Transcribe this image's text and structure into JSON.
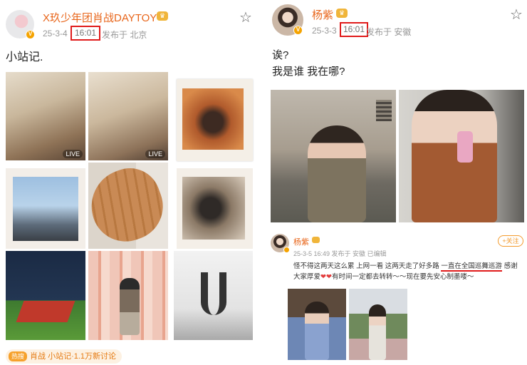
{
  "left_post": {
    "username": "X玖少年团肖战DAYTOY",
    "date": "25-3-4",
    "time": "16:01",
    "location": "发布于 北京",
    "text": "小站记.",
    "live_label_1": "LIVE",
    "live_label_2": "LIVE",
    "topic_chip": {
      "tag": "热搜",
      "text": "肖战 小站记·1.1万新讨论"
    }
  },
  "right_post": {
    "username": "杨紫",
    "date": "25-3-3",
    "time": "16:01",
    "location": "发布于 安徽",
    "text_line_1": "诶?",
    "text_line_2": "我是谁 我在哪?",
    "embedded_post": {
      "username": "杨紫",
      "meta": "25-3-5 16:49 发布于 安徽  已编辑",
      "follow_label": "+关注",
      "text_before": "怪不得这两天这么累 上网一看 这两天走了好多路 ",
      "text_highlight": "一直在全国巡舞巡游",
      "text_after": " 感谢大家厚爱",
      "hearts": "❤❤",
      "text_end": "有时间一定都去转转～～现在要先安心制墨喽～"
    }
  },
  "icons": {
    "verified": "V",
    "crown": "♛",
    "star": "☆"
  },
  "colors": {
    "username": "#e8651a",
    "highlight_box": "#e01b1b",
    "badge": "#f5a300"
  }
}
